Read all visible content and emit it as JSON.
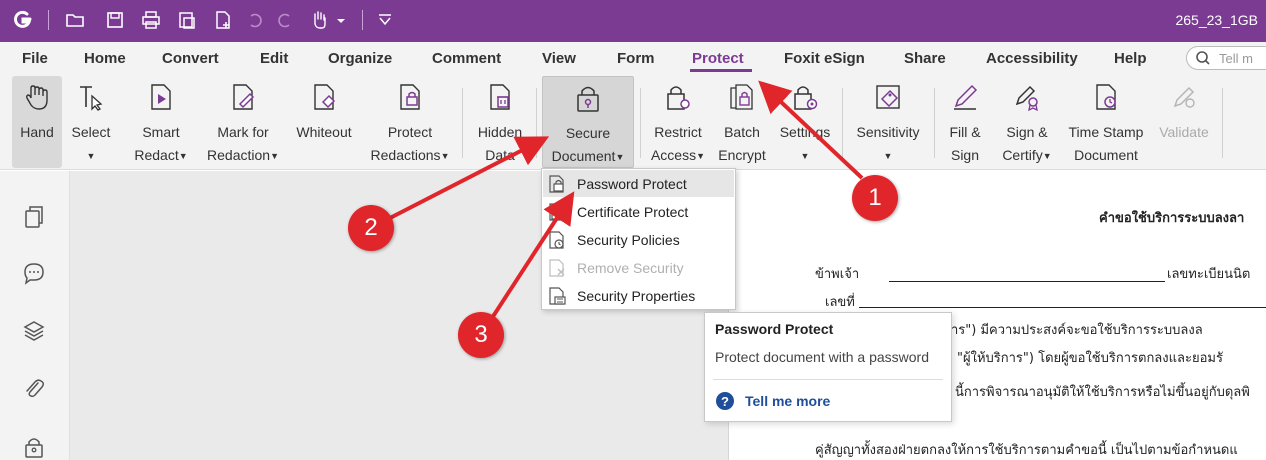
{
  "titlebar": {
    "doc_title": "265_23_1GB",
    "icons": [
      "foxit-logo-icon",
      "open-icon",
      "save-icon",
      "print-icon",
      "page-icon",
      "new-icon",
      "undo-icon",
      "redo-icon",
      "hand-tool-icon",
      "customize-icon"
    ]
  },
  "menu": {
    "items": [
      "File",
      "Home",
      "Convert",
      "Edit",
      "Organize",
      "Comment",
      "View",
      "Form",
      "Protect",
      "Foxit eSign",
      "Share",
      "Accessibility",
      "Help"
    ],
    "active": "Protect",
    "accent_color": "#7c3b92",
    "tell_me_placeholder": "Tell m"
  },
  "ribbon": {
    "hand": {
      "l1": "Hand"
    },
    "select": {
      "l1": "Select"
    },
    "smart_redact": {
      "l1": "Smart",
      "l2": "Redact"
    },
    "mark_for_redaction": {
      "l1": "Mark for",
      "l2": "Redaction"
    },
    "whiteout": {
      "l1": "Whiteout"
    },
    "protect_redactions": {
      "l1": "Protect",
      "l2": "Redactions"
    },
    "hidden_data": {
      "l1": "Hidden",
      "l2": "Data"
    },
    "secure_document": {
      "l1": "Secure",
      "l2": "Document"
    },
    "restrict_access": {
      "l1": "Restrict",
      "l2": "Access"
    },
    "batch_encrypt": {
      "l1": "Batch",
      "l2": "Encrypt"
    },
    "settings": {
      "l1": "Settings"
    },
    "sensitivity": {
      "l1": "Sensitivity"
    },
    "fill_sign": {
      "l1": "Fill &",
      "l2": "Sign"
    },
    "sign_certify": {
      "l1": "Sign &",
      "l2": "Certify"
    },
    "time_stamp": {
      "l1": "Time Stamp",
      "l2": "Document"
    },
    "validate": {
      "l1": "Validate"
    }
  },
  "dropdown": {
    "items": [
      {
        "label": "Password Protect",
        "icon": "password-lock-icon",
        "state": "hover"
      },
      {
        "label": "Certificate Protect",
        "icon": "certificate-lock-icon",
        "state": "normal"
      },
      {
        "label": "Security Policies",
        "icon": "policy-lock-icon",
        "state": "normal"
      },
      {
        "label": "Remove Security",
        "icon": "remove-lock-icon",
        "state": "disabled"
      },
      {
        "label": "Security Properties",
        "icon": "properties-lock-icon",
        "state": "normal"
      }
    ]
  },
  "tooltip": {
    "title": "Password Protect",
    "description": "Protect document with a password",
    "link": "Tell me more"
  },
  "sidebar": {
    "icons": [
      "pages-icon",
      "comments-icon",
      "layers-icon",
      "attachments-icon",
      "security-icon"
    ]
  },
  "document": {
    "heading": "คำขอใช้บริการระบบลงลา",
    "line1_a": "ข้าพเจ้า",
    "line1_b": "เลขทะเบียนนิต",
    "line2": "เลขที่",
    "line3": "าร\") มีความประสงค์จะขอใช้บริการระบบลงล",
    "line4": "\"ผู้ให้บริการ\") โดยผู้ขอใช้บริการตกลงและยอมรั",
    "line5": "นี้การพิจารณาอนุมัติให้ใช้บริการหรือไม่ขึ้นอยู่กับดุลพิ",
    "line6": "คู่สัญญาทั้งสองฝ่ายตกลงให้การใช้บริการตามคำขอนี้ เป็นไปตามข้อกำหนดแ"
  },
  "annotations": {
    "badges": [
      "1",
      "2",
      "3"
    ],
    "color": "#e0262a"
  }
}
